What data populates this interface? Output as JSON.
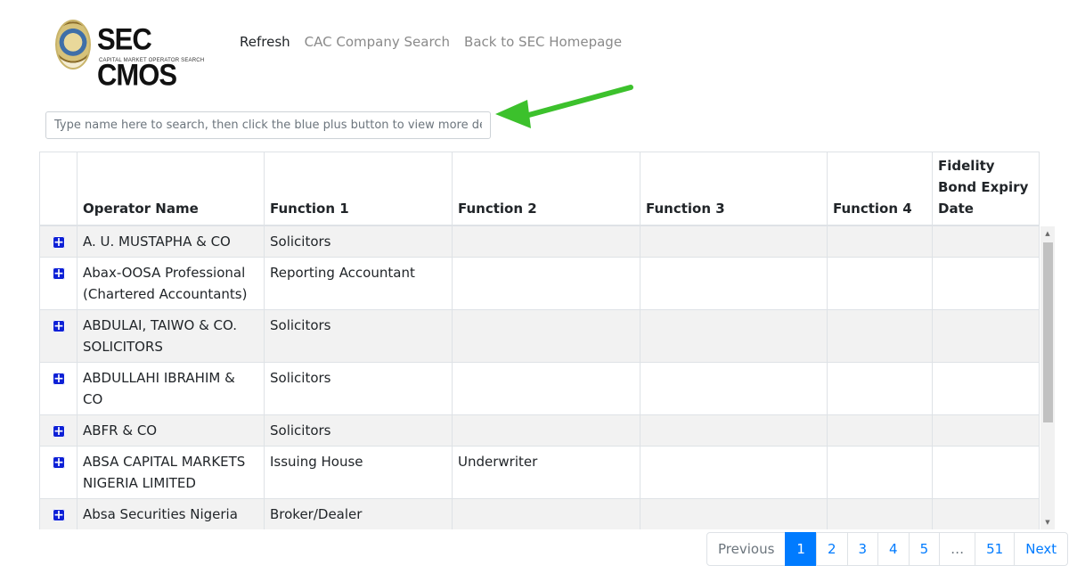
{
  "header": {
    "logo_title": "SEC CMOS",
    "logo_subtitle": "CAPITAL MARKET OPERATOR SEARCH",
    "nav": [
      {
        "label": "Refresh"
      },
      {
        "label": "CAC Company Search"
      },
      {
        "label": "Back to SEC Homepage"
      }
    ]
  },
  "search": {
    "placeholder": "Type name here to search, then click the blue plus button to view more details",
    "value": ""
  },
  "table": {
    "headers": [
      "",
      "Operator Name",
      "Function 1",
      "Function 2",
      "Function 3",
      "Function 4",
      "Fidelity Bond Expiry Date"
    ],
    "rows": [
      {
        "name": "A. U. MUSTAPHA & CO",
        "f1": "Solicitors",
        "f2": "",
        "f3": "",
        "f4": "",
        "fidelity": ""
      },
      {
        "name": "Abax-OOSA Professional (Chartered Accountants)",
        "f1": "Reporting Accountant",
        "f2": "",
        "f3": "",
        "f4": "",
        "fidelity": ""
      },
      {
        "name": "ABDULAI, TAIWO & CO. SOLICITORS",
        "f1": "Solicitors",
        "f2": "",
        "f3": "",
        "f4": "",
        "fidelity": ""
      },
      {
        "name": "ABDULLAHI IBRAHIM & CO",
        "f1": "Solicitors",
        "f2": "",
        "f3": "",
        "f4": "",
        "fidelity": ""
      },
      {
        "name": "ABFR & CO",
        "f1": "Solicitors",
        "f2": "",
        "f3": "",
        "f4": "",
        "fidelity": ""
      },
      {
        "name": "ABSA CAPITAL MARKETS NIGERIA LIMITED",
        "f1": "Issuing House",
        "f2": "Underwriter",
        "f3": "",
        "f4": "",
        "fidelity": ""
      },
      {
        "name": "Absa Securities Nigeria Limited",
        "f1": "Broker/Dealer",
        "f2": "",
        "f3": "",
        "f4": "",
        "fidelity": ""
      }
    ]
  },
  "pagination": {
    "previous": "Previous",
    "pages": [
      "1",
      "2",
      "3",
      "4",
      "5",
      "…",
      "51"
    ],
    "active": "1",
    "next": "Next"
  },
  "colors": {
    "accent": "#007bff",
    "plus_button": "#0d20d6",
    "annotation_arrow": "#3cc12c"
  },
  "icons": {
    "expand": "plus-square-icon",
    "annotation": "green-arrow-icon"
  }
}
